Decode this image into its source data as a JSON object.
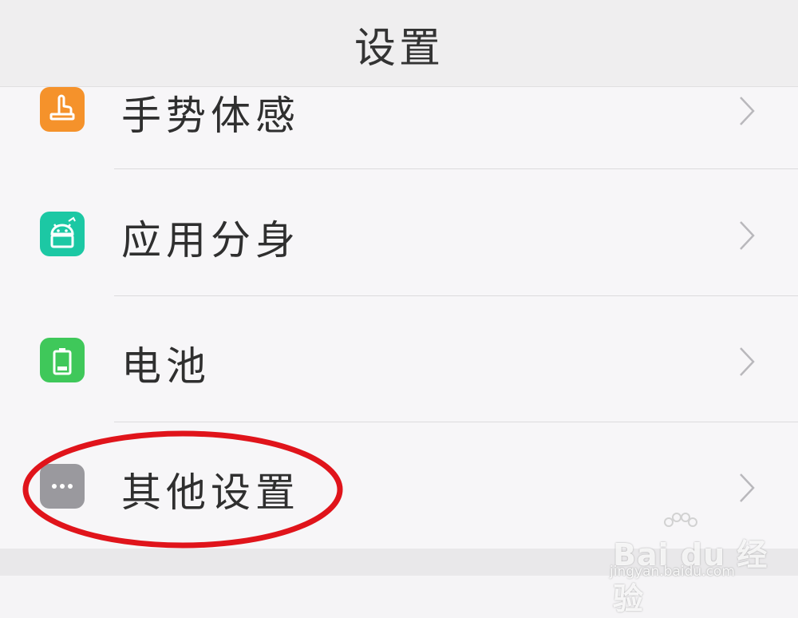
{
  "header": {
    "title": "设置"
  },
  "list": {
    "items": [
      {
        "label": "手势体感",
        "icon": "gesture-hand-icon",
        "color": "#f5922b"
      },
      {
        "label": "应用分身",
        "icon": "android-app-clone-icon",
        "color": "#1cc8a4"
      },
      {
        "label": "电池",
        "icon": "battery-icon",
        "color": "#3fc85a"
      },
      {
        "label": "其他设置",
        "icon": "more-dots-icon",
        "color": "#9a999e"
      }
    ]
  },
  "annotation": {
    "color": "#e0141b"
  },
  "watermark": {
    "brand": "Bai du 经验",
    "url": "jingyan.baidu.com"
  }
}
